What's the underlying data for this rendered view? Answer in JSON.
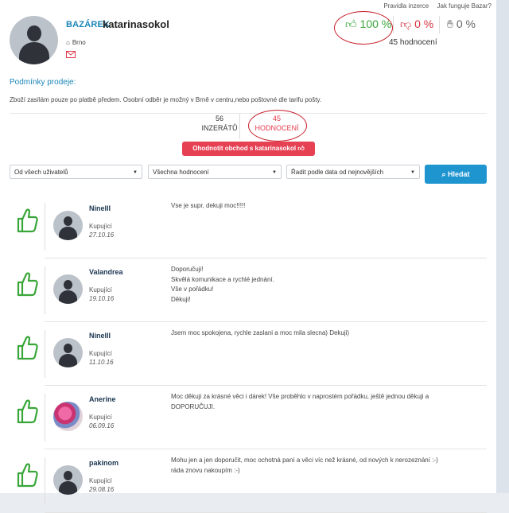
{
  "top_links": [
    "Pravidla inzerce",
    "Jak funguje Bazar?"
  ],
  "profile": {
    "brand": "BAZÁREK",
    "username": "katarinasokol",
    "location": "Brno"
  },
  "stats": {
    "positive": "100 %",
    "negative": "0 %",
    "neutral": "0 %",
    "ratings_count": "45 hodnocení"
  },
  "conditions": {
    "title": "Podmínky prodeje:",
    "text": "Zboží zasílám pouze po platbě předem. Osobní odběr je možný v Brně v centru,nebo poštovné dle tarifu pošty."
  },
  "tabs": [
    {
      "count": "56",
      "label": "INZERÁTŮ"
    },
    {
      "count": "45",
      "label": "HODNOCENÍ"
    }
  ],
  "rate_button": "Ohodnotit obchod s katarinasokol",
  "filters": {
    "users": "Od všech uživatelů",
    "ratings": "Všechna hodnocení",
    "sort": "Řadit podle data od nejnovějších",
    "search": "Hledat"
  },
  "colors": {
    "accent": "#1b86b9",
    "positive": "#3aa63a",
    "negative": "#d9333f",
    "rate_button": "#e64053"
  },
  "reviews": [
    {
      "name": "NinelII",
      "role": "Kupující",
      "date": "27.10.16",
      "lines": [
        "Vse je supr, dekuji moc!!!!!"
      ]
    },
    {
      "name": "Valandrea",
      "role": "Kupující",
      "date": "19.10.16",
      "lines": [
        "Doporučuji!",
        "Skvělá komunikace a rychlé jednání.",
        "Vše v pořádku!",
        "Děkuji!"
      ]
    },
    {
      "name": "NinelII",
      "role": "Kupující",
      "date": "11.10.16",
      "lines": [
        "Jsem moc spokojena, rychle zaslani a moc mila slecna) Dekuji)"
      ]
    },
    {
      "name": "Anerine",
      "role": "Kupující",
      "date": "06.09.16",
      "lines": [
        "Moc děkuji za krásné věci i dárek! Vše proběhlo v naprostém pořádku, ještě jednou děkuji a DOPORUČUJI."
      ]
    },
    {
      "name": "pakinom",
      "role": "Kupující",
      "date": "29.08.16",
      "lines": [
        "Mohu jen a jen doporučit, moc ochotná paní a věci víc než krásné, od nových k nerozeznání :-)",
        "ráda znovu nakoupím :-)"
      ]
    }
  ]
}
